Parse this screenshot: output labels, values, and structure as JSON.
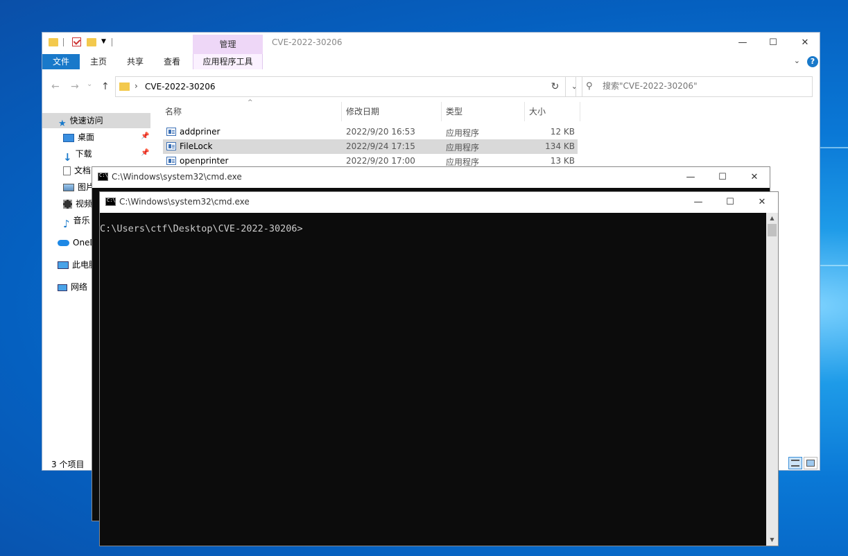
{
  "explorer": {
    "title": "CVE-2022-30206",
    "context_tab": "管理",
    "ribbon_tabs": [
      "文件",
      "主页",
      "共享",
      "查看",
      "应用程序工具"
    ],
    "help_label": "?",
    "address_path": "CVE-2022-30206",
    "search_placeholder": "搜索\"CVE-2022-30206\"",
    "columns": {
      "name": "名称",
      "date": "修改日期",
      "type": "类型",
      "size": "大小"
    },
    "sidebar": [
      {
        "label": "快速访问",
        "icon": "star-icon"
      },
      {
        "label": "桌面",
        "icon": "desktop-icon"
      },
      {
        "label": "下载",
        "icon": "download-icon"
      },
      {
        "label": "文档",
        "icon": "document-icon"
      },
      {
        "label": "图片",
        "icon": "picture-icon"
      },
      {
        "label": "视频",
        "icon": "video-icon"
      },
      {
        "label": "音乐",
        "icon": "music-icon"
      },
      {
        "label": "OneDrive",
        "icon": "cloud-icon"
      },
      {
        "label": "此电脑",
        "icon": "pc-icon"
      },
      {
        "label": "网络",
        "icon": "network-icon"
      }
    ],
    "files": [
      {
        "name": "addpriner",
        "date": "2022/9/20 16:53",
        "type": "应用程序",
        "size": "12 KB"
      },
      {
        "name": "FileLock",
        "date": "2022/9/24 17:15",
        "type": "应用程序",
        "size": "134 KB"
      },
      {
        "name": "openprinter",
        "date": "2022/9/20 17:00",
        "type": "应用程序",
        "size": "13 KB"
      }
    ],
    "status": "3 个项目"
  },
  "cmd_back": {
    "title": "C:\\Windows\\system32\\cmd.exe"
  },
  "cmd_front": {
    "title": "C:\\Windows\\system32\\cmd.exe",
    "prompt": "C:\\Users\\ctf\\Desktop\\CVE-2022-30206>"
  },
  "colors": {
    "accent": "#1979ca",
    "context_tab": "#eed7f7",
    "selection": "#d9d9d9",
    "console_bg": "#0c0c0c"
  }
}
